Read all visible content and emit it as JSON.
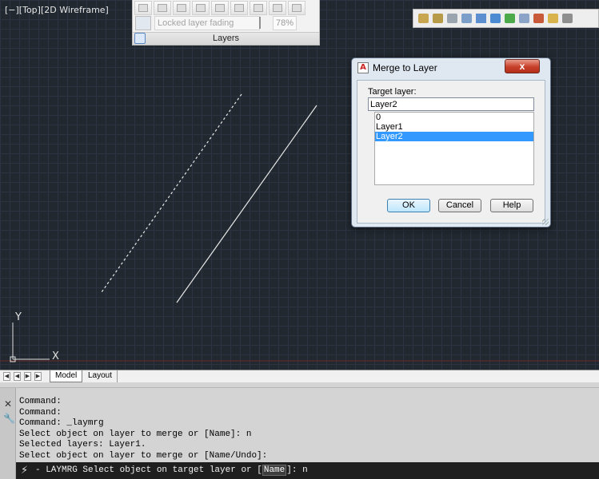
{
  "viewport": {
    "label": "[−][Top][2D Wireframe]",
    "ucs": {
      "y_label": "Y",
      "x_label": "X"
    }
  },
  "layers_panel": {
    "title": "Layers",
    "locked_layer_fading_label": "Locked layer fading",
    "locked_layer_fading_value": "78%",
    "fading_fraction": 0.78
  },
  "dialog": {
    "title": "Merge to Layer",
    "close_label": "x",
    "target_layer_label": "Target layer:",
    "target_layer_value": "Layer2",
    "layers": [
      {
        "name": "0",
        "selected": false
      },
      {
        "name": "Layer1",
        "selected": false
      },
      {
        "name": "Layer2",
        "selected": true
      }
    ],
    "buttons": {
      "ok": "OK",
      "cancel": "Cancel",
      "help": "Help"
    }
  },
  "tabs": {
    "model": "Model",
    "layout": "Layout"
  },
  "command": {
    "history": [
      "Command:",
      "Command:",
      "Command: _laymrg",
      "Select object on layer to merge or [Name]: n",
      "Selected layers: Layer1.",
      "Select object on layer to merge or [Name/Undo]:"
    ],
    "prompt_prefix": "- LAYMRG Select object on target layer or [",
    "prompt_keyword": "Name",
    "prompt_suffix": "]: n"
  },
  "colors": {
    "canvas": "#212830",
    "grid": "#2b3440",
    "selection": "#3399ff",
    "close_button": "#c7412a"
  }
}
